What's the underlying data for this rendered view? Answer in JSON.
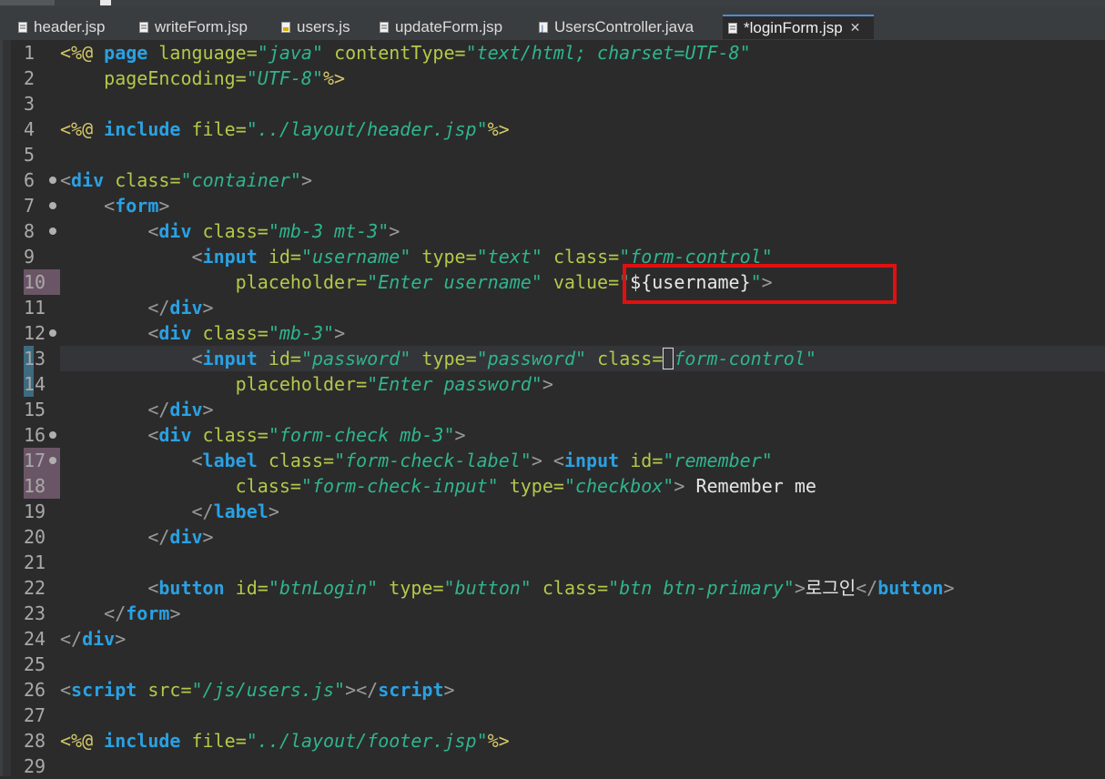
{
  "tabs": [
    {
      "label": "header.jsp",
      "icon": "jsp-file-icon",
      "active": false
    },
    {
      "label": "writeForm.jsp",
      "icon": "jsp-file-icon",
      "active": false
    },
    {
      "label": "users.js",
      "icon": "js-file-icon",
      "active": false
    },
    {
      "label": "updateForm.jsp",
      "icon": "jsp-file-icon",
      "active": false
    },
    {
      "label": "UsersController.java",
      "icon": "java-file-icon",
      "active": false
    },
    {
      "label": "*loginForm.jsp",
      "icon": "jsp-file-icon",
      "active": true,
      "close": "✕"
    }
  ],
  "line_numbers": [
    "1",
    "2",
    "3",
    "4",
    "5",
    "6",
    "7",
    "8",
    "9",
    "10",
    "11",
    "12",
    "13",
    "14",
    "15",
    "16",
    "17",
    "18",
    "19",
    "20",
    "21",
    "22",
    "23",
    "24",
    "25",
    "26",
    "27",
    "28",
    "29"
  ],
  "code": {
    "l1": {
      "d1": "<%@",
      "kw": "page",
      "a1": "language",
      "e1": "=",
      "v1": "\"java\"",
      "a2": "contentType",
      "e2": "=",
      "v2": "\"text/html; charset=UTF-8\""
    },
    "l2": {
      "a1": "pageEncoding",
      "e1": "=",
      "v1": "\"UTF-8\"",
      "d2": "%>"
    },
    "l4": {
      "d1": "<%@",
      "kw": "include",
      "a1": "file",
      "e1": "=",
      "v1": "\"../layout/header.jsp\"",
      "d2": "%>"
    },
    "l6": {
      "lt": "<",
      "tag": "div",
      "a1": "class",
      "e1": "=",
      "v1": "\"container\"",
      "gt": ">"
    },
    "l7": {
      "lt": "<",
      "tag": "form",
      "gt": ">"
    },
    "l8": {
      "lt": "<",
      "tag": "div",
      "a1": "class",
      "e1": "=",
      "v1": "\"mb-3 mt-3\"",
      "gt": ">"
    },
    "l9": {
      "lt": "<",
      "tag": "input",
      "a1": "id",
      "e1": "=",
      "v1": "\"username\"",
      "a2": "type",
      "e2": "=",
      "v2": "\"text\"",
      "a3": "class",
      "e3": "=",
      "v3": "\"form-control\""
    },
    "l10": {
      "a1": "placeholder",
      "e1": "=",
      "v1": "\"Enter username\"",
      "a2": "value",
      "e2": "=",
      "v2a": "\"",
      "el": "${username}",
      "v2b": "\"",
      "gt": ">"
    },
    "l11": {
      "lt": "</",
      "tag": "div",
      "gt": ">"
    },
    "l12": {
      "lt": "<",
      "tag": "div",
      "a1": "class",
      "e1": "=",
      "v1": "\"mb-3\"",
      "gt": ">"
    },
    "l13": {
      "lt": "<",
      "tag": "input",
      "a1": "id",
      "e1": "=",
      "v1": "\"password\"",
      "a2": "type",
      "e2": "=",
      "v2": "\"password\"",
      "a3": "class",
      "e3": "=",
      "v3a": "\"",
      "v3b": "form-control\""
    },
    "l14": {
      "a1": "placeholder",
      "e1": "=",
      "v1": "\"Enter password\"",
      "gt": ">"
    },
    "l15": {
      "lt": "</",
      "tag": "div",
      "gt": ">"
    },
    "l16": {
      "lt": "<",
      "tag": "div",
      "a1": "class",
      "e1": "=",
      "v1": "\"form-check mb-3\"",
      "gt": ">"
    },
    "l17": {
      "lt": "<",
      "tag": "label",
      "a1": "class",
      "e1": "=",
      "v1": "\"form-check-label\"",
      "gt": ">",
      "lt2": "<",
      "tag2": "input",
      "a2": "id",
      "e2": "=",
      "v2": "\"remember\""
    },
    "l18": {
      "a1": "class",
      "e1": "=",
      "v1": "\"form-check-input\"",
      "a2": "type",
      "e2": "=",
      "v2": "\"checkbox\"",
      "gt": ">",
      "tx": "Remember me"
    },
    "l19": {
      "lt": "</",
      "tag": "label",
      "gt": ">"
    },
    "l20": {
      "lt": "</",
      "tag": "div",
      "gt": ">"
    },
    "l22": {
      "lt": "<",
      "tag": "button",
      "a1": "id",
      "e1": "=",
      "v1": "\"btnLogin\"",
      "a2": "type",
      "e2": "=",
      "v2": "\"button\"",
      "a3": "class",
      "e3": "=",
      "v3": "\"btn btn-primary\"",
      "gt": ">",
      "tx": "로그인",
      "lt2": "</",
      "tag2": "button",
      "gt2": ">"
    },
    "l23": {
      "lt": "</",
      "tag": "form",
      "gt": ">"
    },
    "l24": {
      "lt": "</",
      "tag": "div",
      "gt": ">"
    },
    "l26": {
      "lt": "<",
      "tag": "script",
      "a1": "src",
      "e1": "=",
      "v1": "\"/js/users.js\"",
      "gt": ">",
      "lt2": "</",
      "tag2": "script",
      "gt2": ">"
    },
    "l28": {
      "d1": "<%@",
      "kw": "include",
      "a1": "file",
      "e1": "=",
      "v1": "\"../layout/footer.jsp\"",
      "d2": "%>"
    }
  },
  "colors": {
    "background": "#2b2b2b",
    "tag": "#2aa1e3",
    "attribute": "#b5c84a",
    "value": "#2fb58d",
    "highlight": "#e01010"
  }
}
